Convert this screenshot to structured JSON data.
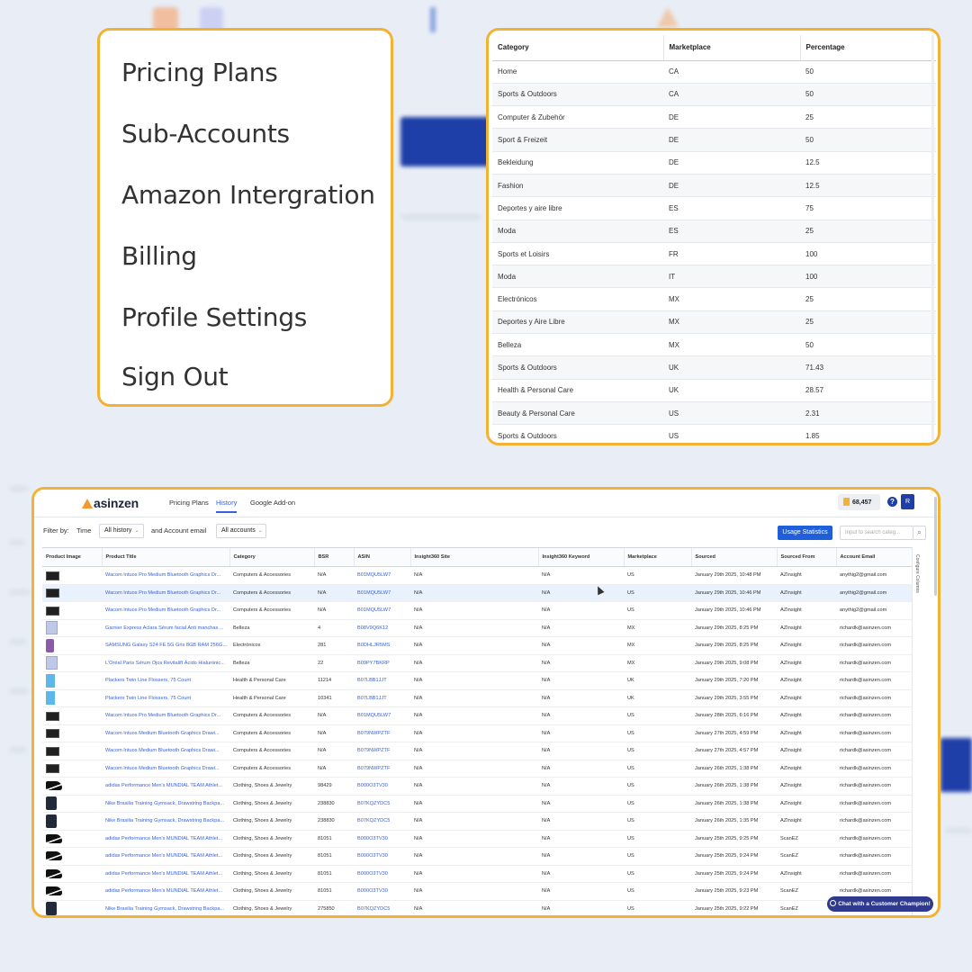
{
  "menu": {
    "items": [
      "Pricing Plans",
      "Sub-Accounts",
      "Amazon Intergration",
      "Billing",
      "Profile Settings",
      "Sign Out"
    ]
  },
  "category_table": {
    "headers": [
      "Category",
      "Marketplace",
      "Percentage"
    ],
    "rows": [
      [
        "Home",
        "CA",
        "50"
      ],
      [
        "Sports & Outdoors",
        "CA",
        "50"
      ],
      [
        "Computer & Zubehör",
        "DE",
        "25"
      ],
      [
        "Sport & Freizeit",
        "DE",
        "50"
      ],
      [
        "Bekleidung",
        "DE",
        "12.5"
      ],
      [
        "Fashion",
        "DE",
        "12.5"
      ],
      [
        "Deportes y aire libre",
        "ES",
        "75"
      ],
      [
        "Moda",
        "ES",
        "25"
      ],
      [
        "Sports et Loisirs",
        "FR",
        "100"
      ],
      [
        "Moda",
        "IT",
        "100"
      ],
      [
        "Electrónicos",
        "MX",
        "25"
      ],
      [
        "Deportes y Aire Libre",
        "MX",
        "25"
      ],
      [
        "Belleza",
        "MX",
        "50"
      ],
      [
        "Sports & Outdoors",
        "UK",
        "71.43"
      ],
      [
        "Health & Personal Care",
        "UK",
        "28.57"
      ],
      [
        "Beauty & Personal Care",
        "US",
        "2.31"
      ],
      [
        "Sports & Outdoors",
        "US",
        "1.85"
      ]
    ]
  },
  "app": {
    "logo": "asinzen",
    "nav": [
      "Pricing Plans",
      "History",
      "Google Add-on"
    ],
    "active_nav": "History",
    "credits": "68,457",
    "help": "?",
    "avatar": "R",
    "filter_label": "Filter by:",
    "time_label": "Time",
    "time_value": "All history",
    "email_label": "and Account email",
    "email_value": "All accounts",
    "usage_button": "Usage Statistics",
    "search_placeholder": "Input to search categ...",
    "side_rail": "Configure Columns",
    "chat_button": "Chat with a Customer Champion!"
  },
  "history_table": {
    "headers": [
      "Product Image",
      "Product Title",
      "Category",
      "BSR",
      "ASIN",
      "Insight360 Site",
      "Insight360 Keyword",
      "Marketplace",
      "Sourced",
      "Sourced From",
      "Account Email"
    ],
    "rows": [
      {
        "img": "tablet",
        "title": "Wacom Intuos Pro Medium Bluetooth Graphics Dr...",
        "category": "Computers & Accessories",
        "bsr": "N/A",
        "asin": "B01MQU5LW7",
        "site": "N/A",
        "keyword": "N/A",
        "market": "US",
        "sourced": "January 29th 2025, 10:48 PM",
        "from": "AZInsight",
        "email": "anythig2@gmail.com"
      },
      {
        "img": "tablet",
        "title": "Wacom Intuos Pro Medium Bluetooth Graphics Dr...",
        "category": "Computers & Accessories",
        "bsr": "N/A",
        "asin": "B01MQU5LW7",
        "site": "N/A",
        "keyword": "N/A",
        "market": "US",
        "sourced": "January 29th 2025, 10:46 PM",
        "from": "AZInsight",
        "email": "anythig2@gmail.com"
      },
      {
        "img": "tablet",
        "title": "Wacom Intuos Pro Medium Bluetooth Graphics Dr...",
        "category": "Computers & Accessories",
        "bsr": "N/A",
        "asin": "B01MQU5LW7",
        "site": "N/A",
        "keyword": "N/A",
        "market": "US",
        "sourced": "January 29th 2025, 10:46 PM",
        "from": "AZInsight",
        "email": "anythig2@gmail.com"
      },
      {
        "img": "box",
        "title": "Garnier Express Aclara Sérum facial Anti manchas ...",
        "category": "Belleza",
        "bsr": "4",
        "asin": "B08V9Q6K12",
        "site": "N/A",
        "keyword": "N/A",
        "market": "MX",
        "sourced": "January 29th 2025, 8:25 PM",
        "from": "AZInsight",
        "email": "richardk@asinzen.com"
      },
      {
        "img": "phone",
        "title": "SAMSUNG Galaxy S24 FE 5G Gris 8GB RAM 256GB...",
        "category": "Electrónicos",
        "bsr": "281",
        "asin": "B0DHLJR5MS",
        "site": "N/A",
        "keyword": "N/A",
        "market": "MX",
        "sourced": "January 29th 2025, 8:25 PM",
        "from": "AZInsight",
        "email": "richardk@asinzen.com"
      },
      {
        "img": "box",
        "title": "L'Oréal Paris Sérum Ojos Revitalift Ácido Hialurónic...",
        "category": "Belleza",
        "bsr": "22",
        "asin": "B09PY7BKRP",
        "site": "N/A",
        "keyword": "N/A",
        "market": "MX",
        "sourced": "January 29th 2025, 9:08 PM",
        "from": "AZInsight",
        "email": "richardk@asinzen.com"
      },
      {
        "img": "floss",
        "title": "Plackers Twin Line Flossers, 75 Count",
        "category": "Health & Personal Care",
        "bsr": "11214",
        "asin": "B07LBB1JJT",
        "site": "N/A",
        "keyword": "N/A",
        "market": "UK",
        "sourced": "January 29th 2025, 7:20 PM",
        "from": "AZInsight",
        "email": "richardk@asinzen.com"
      },
      {
        "img": "floss",
        "title": "Plackers Twin Line Flossers, 75 Count",
        "category": "Health & Personal Care",
        "bsr": "10341",
        "asin": "B07LBB1JJT",
        "site": "N/A",
        "keyword": "N/A",
        "market": "UK",
        "sourced": "January 29th 2025, 3:55 PM",
        "from": "AZInsight",
        "email": "richardk@asinzen.com"
      },
      {
        "img": "tablet",
        "title": "Wacom Intuos Pro Medium Bluetooth Graphics Dr...",
        "category": "Computers & Accessories",
        "bsr": "N/A",
        "asin": "B01MQU5LW7",
        "site": "N/A",
        "keyword": "N/A",
        "market": "US",
        "sourced": "January 28th 2025, 6:16 PM",
        "from": "AZInsight",
        "email": "richardk@asinzen.com"
      },
      {
        "img": "tablet",
        "title": "Wacom Intuos Medium Bluetooth Graphics Drawi...",
        "category": "Computers & Accessories",
        "bsr": "N/A",
        "asin": "B079NWPZTF",
        "site": "N/A",
        "keyword": "N/A",
        "market": "US",
        "sourced": "January 27th 2025, 4:59 PM",
        "from": "AZInsight",
        "email": "richardk@asinzen.com"
      },
      {
        "img": "tablet",
        "title": "Wacom Intuos Medium Bluetooth Graphics Drawi...",
        "category": "Computers & Accessories",
        "bsr": "N/A",
        "asin": "B079NWPZTF",
        "site": "N/A",
        "keyword": "N/A",
        "market": "US",
        "sourced": "January 27th 2025, 4:57 PM",
        "from": "AZInsight",
        "email": "richardk@asinzen.com"
      },
      {
        "img": "tablet",
        "title": "Wacom Intuos Medium Bluetooth Graphics Drawi...",
        "category": "Computers & Accessories",
        "bsr": "N/A",
        "asin": "B079NWPZTF",
        "site": "N/A",
        "keyword": "N/A",
        "market": "US",
        "sourced": "January 26th 2025, 1:38 PM",
        "from": "AZInsight",
        "email": "richardk@asinzen.com"
      },
      {
        "img": "shoe",
        "title": "adidas Performance Men's MUNDIAL TEAM Athlet...",
        "category": "Clothing, Shoes & Jewelry",
        "bsr": "98429",
        "asin": "B000O3TV30",
        "site": "N/A",
        "keyword": "N/A",
        "market": "US",
        "sourced": "January 26th 2025, 1:38 PM",
        "from": "AZInsight",
        "email": "richardk@asinzen.com"
      },
      {
        "img": "bag",
        "title": "Nike Brasilia Training Gymsack, Drawstring Backpa...",
        "category": "Clothing, Shoes & Jewelry",
        "bsr": "238830",
        "asin": "B07KQZYDC5",
        "site": "N/A",
        "keyword": "N/A",
        "market": "US",
        "sourced": "January 26th 2025, 1:38 PM",
        "from": "AZInsight",
        "email": "richardk@asinzen.com"
      },
      {
        "img": "bag",
        "title": "Nike Brasilia Training Gymsack, Drawstring Backpa...",
        "category": "Clothing, Shoes & Jewelry",
        "bsr": "238830",
        "asin": "B07KQZYDC5",
        "site": "N/A",
        "keyword": "N/A",
        "market": "US",
        "sourced": "January 26th 2025, 1:35 PM",
        "from": "AZInsight",
        "email": "richardk@asinzen.com"
      },
      {
        "img": "shoe",
        "title": "adidas Performance Men's MUNDIAL TEAM Athlet...",
        "category": "Clothing, Shoes & Jewelry",
        "bsr": "81051",
        "asin": "B000O3TV30",
        "site": "N/A",
        "keyword": "N/A",
        "market": "US",
        "sourced": "January 25th 2025, 9:25 PM",
        "from": "ScanEZ",
        "email": "richardk@asinzen.com"
      },
      {
        "img": "shoe",
        "title": "adidas Performance Men's MUNDIAL TEAM Athlet...",
        "category": "Clothing, Shoes & Jewelry",
        "bsr": "81051",
        "asin": "B000O3TV30",
        "site": "N/A",
        "keyword": "N/A",
        "market": "US",
        "sourced": "January 25th 2025, 9:24 PM",
        "from": "ScanEZ",
        "email": "richardk@asinzen.com"
      },
      {
        "img": "shoe",
        "title": "adidas Performance Men's MUNDIAL TEAM Athlet...",
        "category": "Clothing, Shoes & Jewelry",
        "bsr": "81051",
        "asin": "B000O3TV30",
        "site": "N/A",
        "keyword": "N/A",
        "market": "US",
        "sourced": "January 25th 2025, 9:24 PM",
        "from": "AZInsight",
        "email": "richardk@asinzen.com"
      },
      {
        "img": "shoe",
        "title": "adidas Performance Men's MUNDIAL TEAM Athlet...",
        "category": "Clothing, Shoes & Jewelry",
        "bsr": "81051",
        "asin": "B000O3TV30",
        "site": "N/A",
        "keyword": "N/A",
        "market": "US",
        "sourced": "January 25th 2025, 9:23 PM",
        "from": "ScanEZ",
        "email": "richardk@asinzen.com"
      },
      {
        "img": "bag",
        "title": "Nike Brasilia Training Gymsack, Drawstring Backpa...",
        "category": "Clothing, Shoes & Jewelry",
        "bsr": "275850",
        "asin": "B07KQZYDC5",
        "site": "N/A",
        "keyword": "N/A",
        "market": "US",
        "sourced": "January 25th 2025, 9:22 PM",
        "from": "ScanEZ",
        "email": "richardk@asinzen.com"
      }
    ],
    "highlight_row": 1
  },
  "colors": {
    "accent_border": "#f2b233",
    "primary": "#1f5fd9",
    "link": "#3a62d8",
    "navy": "#1e3fa8"
  }
}
